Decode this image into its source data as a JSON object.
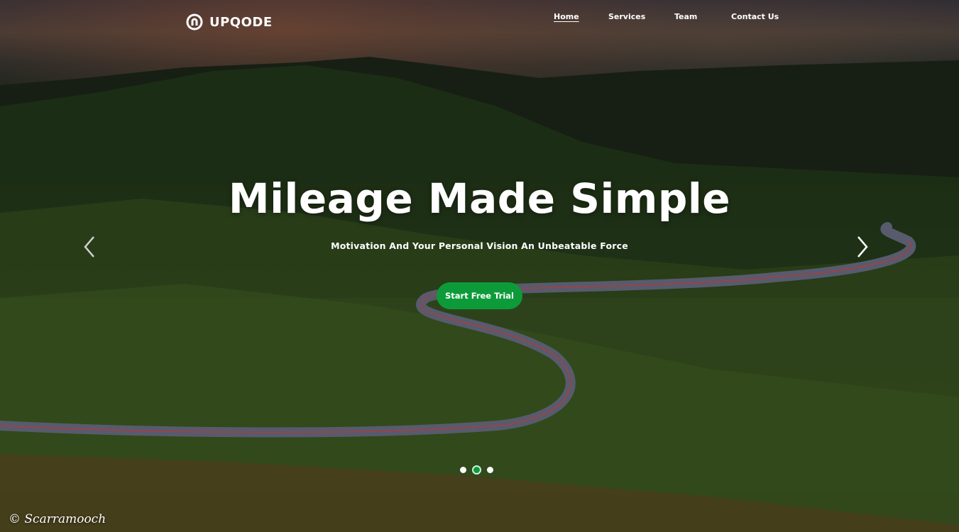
{
  "brand": {
    "name": "UPQODE",
    "logo_icon": "upqode-logo-icon"
  },
  "nav": {
    "items": [
      {
        "label": "Home",
        "active": true
      },
      {
        "label": "Services",
        "active": false
      },
      {
        "label": "Team",
        "active": false
      },
      {
        "label": "Contact Us",
        "active": false
      }
    ]
  },
  "hero": {
    "title": "Mileage Made Simple",
    "subtitle": "Motivation And Your Personal Vision An Unbeatable Force",
    "cta_label": "Start Free Trial",
    "prev_icon": "chevron-left-icon",
    "next_icon": "chevron-right-icon"
  },
  "slider": {
    "slide_count": 3,
    "active_slide": 2
  },
  "watermark": "© Scarramooch",
  "colors": {
    "accent": "#0d9b3a",
    "text": "#ffffff"
  }
}
